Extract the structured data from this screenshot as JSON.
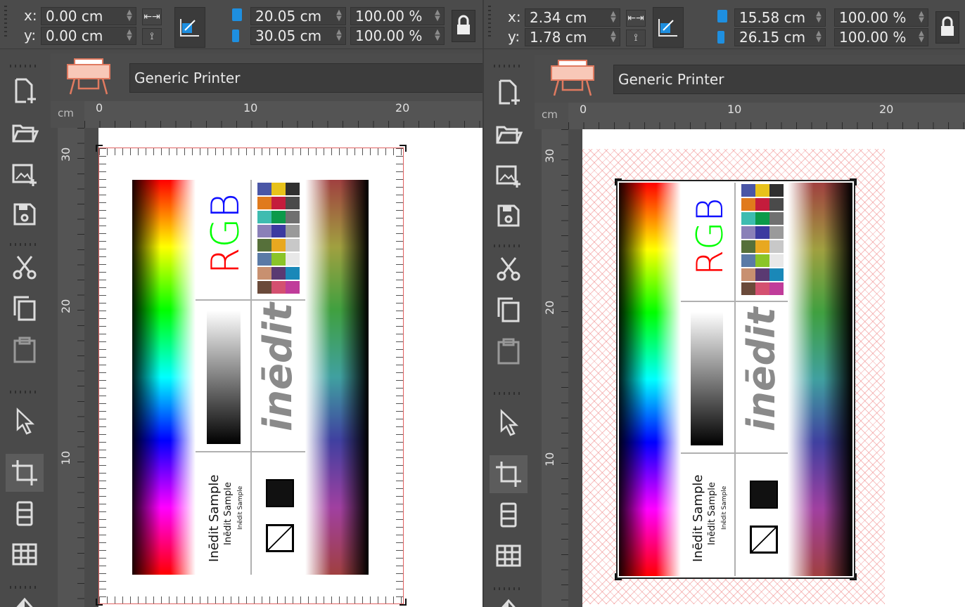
{
  "left_view": {
    "position": {
      "x_label": "x:",
      "x_value": "0.00 cm",
      "y_label": "y:",
      "y_value": "0.00 cm"
    },
    "size": {
      "width_value": "20.05 cm",
      "height_value": "30.05 cm"
    },
    "scale": {
      "x_percent": "100.00 %",
      "y_percent": "100.00 %"
    },
    "printer": "Generic Printer",
    "ruler_unit": "cm",
    "h_ruler_labels": [
      "0",
      "10",
      "20"
    ],
    "v_ruler_labels": [
      "30",
      "20",
      "10"
    ]
  },
  "right_view": {
    "position": {
      "x_label": "x:",
      "x_value": "2.34 cm",
      "y_label": "y:",
      "y_value": "1.78 cm"
    },
    "size": {
      "width_value": "15.58 cm",
      "height_value": "26.15 cm"
    },
    "scale": {
      "x_percent": "100.00 %",
      "y_percent": "100.00 %"
    },
    "printer": "Generic Printer",
    "ruler_unit": "cm",
    "h_ruler_labels": [
      "0",
      "10",
      "20"
    ],
    "v_ruler_labels": [
      "30",
      "20",
      "10"
    ]
  },
  "sample": {
    "rgb_r": "R",
    "rgb_g": "G",
    "rgb_b": "B",
    "brand": "inēdit",
    "sample_lines": [
      "Inēdit Sample",
      "Inēdit Sample",
      "Inēdit Sample"
    ],
    "swatch_rows": [
      [
        "#4a56a6",
        "#e8c21a",
        "#303030"
      ],
      [
        "#e07a1c",
        "#c41c3c",
        "#4a4a4a"
      ],
      [
        "#3ebcb0",
        "#0c9a4a",
        "#707070"
      ],
      [
        "#8a80b8",
        "#3c3aa0",
        "#9a9a9a"
      ],
      [
        "#56703a",
        "#e8a820",
        "#c8c8c8"
      ],
      [
        "#5a7aa6",
        "#8ac428",
        "#e8e8e8"
      ],
      [
        "#c89070",
        "#5a3a72",
        "#1a88b8"
      ],
      [
        "#6a4a3a",
        "#d45070",
        "#c03c9a"
      ]
    ]
  },
  "tools": [
    "new-document",
    "open-folder",
    "import-image",
    "save",
    "cut",
    "copy",
    "paste",
    "select-arrow",
    "crop",
    "rows-layout",
    "grid-layout",
    "fill"
  ],
  "colors": {
    "accent_blue": "#1e8fe0",
    "panel": "#4a4a4a",
    "ruler": "#545454"
  }
}
